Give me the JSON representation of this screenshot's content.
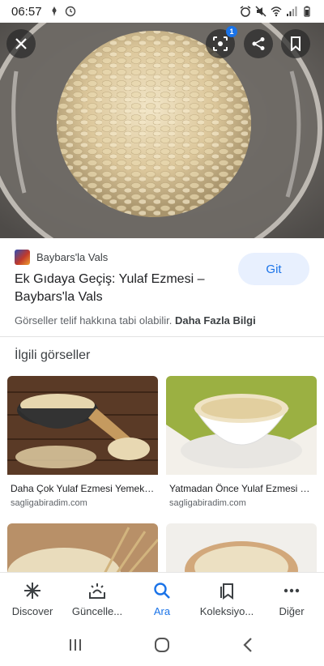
{
  "status_bar": {
    "time": "06:57"
  },
  "source": {
    "name": "Baybars'la Vals"
  },
  "visit_button": {
    "label": "Git"
  },
  "result": {
    "title": "Ek Gıdaya Geçiş: Yulaf Ezmesi – Baybars'la Vals"
  },
  "copyright": {
    "text": "Görseller telif hakkına tabi olabilir.",
    "more_link": "Daha Fazla Bilgi"
  },
  "lens": {
    "badge": "1"
  },
  "related": {
    "heading": "İlgili görseller",
    "items": [
      {
        "title": "Daha Çok Yulaf Ezmesi Yemek İçin…",
        "source": "sagligabiradim.com"
      },
      {
        "title": "Yatmadan Önce Yulaf Ezmesi Yem…",
        "source": "sagligabiradim.com"
      }
    ]
  },
  "bottom_nav": {
    "items": [
      {
        "label": "Discover",
        "icon": "asterisk-icon"
      },
      {
        "label": "Güncelle...",
        "icon": "updates-icon"
      },
      {
        "label": "Ara",
        "icon": "search-icon"
      },
      {
        "label": "Koleksiyo...",
        "icon": "collections-icon"
      },
      {
        "label": "Diğer",
        "icon": "more-icon"
      }
    ],
    "active_index": 2
  },
  "colors": {
    "accent": "#1a73e8",
    "accent_bg": "#e8f0fe"
  }
}
